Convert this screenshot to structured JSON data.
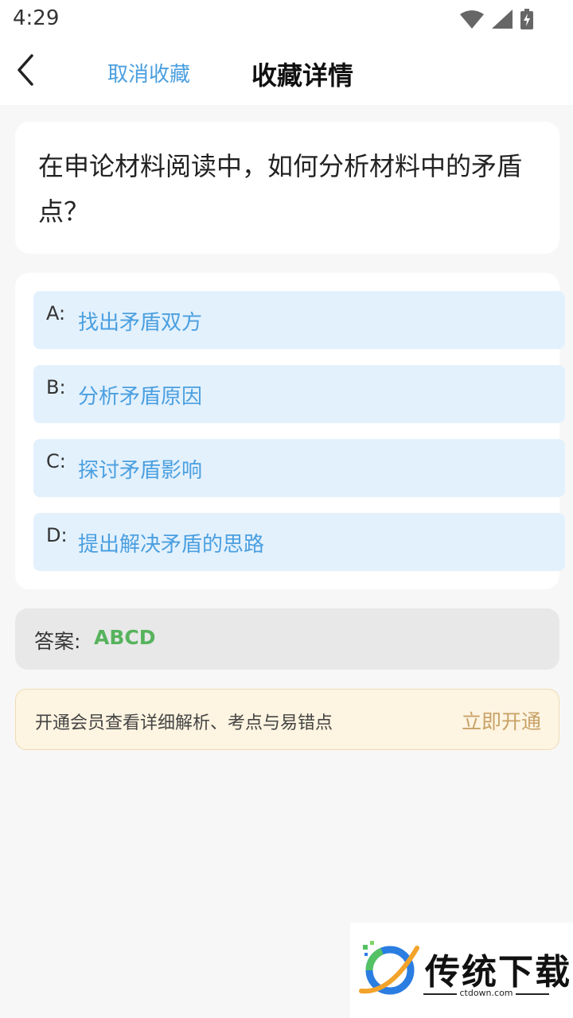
{
  "status_bar": {
    "time": "4:29",
    "icons": [
      "wifi-icon",
      "signal-icon",
      "battery-charging-icon"
    ]
  },
  "header": {
    "back_icon": "chevron-left-icon",
    "cancel_label": "取消收藏",
    "title": "收藏详情"
  },
  "question": {
    "text": "在申论材料阅读中，如何分析材料中的矛盾点？"
  },
  "options": [
    {
      "key": "A:",
      "text": "找出矛盾双方"
    },
    {
      "key": "B:",
      "text": "分析矛盾原因"
    },
    {
      "key": "C:",
      "text": "探讨矛盾影响"
    },
    {
      "key": "D:",
      "text": "提出解决矛盾的思路"
    }
  ],
  "answer": {
    "label": "答案:",
    "value": "ABCD"
  },
  "vip": {
    "text": "开通会员查看详细解析、考点与易错点",
    "button": "立即开通"
  },
  "watermark": {
    "title": "传统下载",
    "url": "ctdown.com"
  },
  "colors": {
    "accent_blue": "#4a9fe0",
    "option_bg": "#e3f1fd",
    "answer_green": "#57b35d",
    "vip_gold": "#c9a267"
  }
}
